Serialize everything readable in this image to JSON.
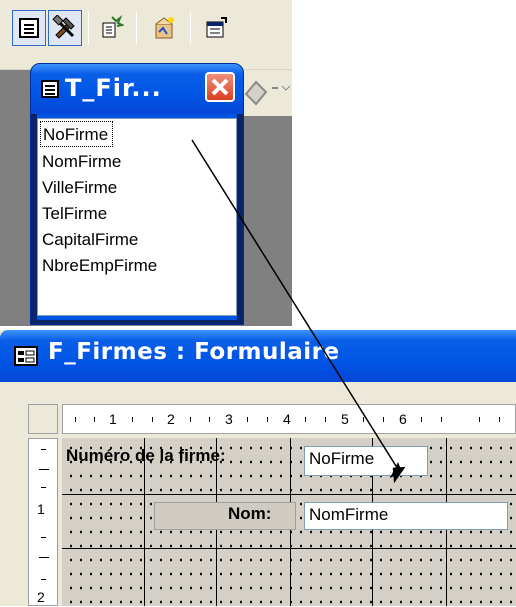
{
  "toolbar": {
    "buttons": [
      {
        "icon": "form-view-icon",
        "pressed": true
      },
      {
        "icon": "toolbox-icon",
        "pressed": true
      },
      {
        "icon": "autoformat-icon",
        "pressed": false
      },
      {
        "icon": "code-wizard-icon",
        "pressed": false
      },
      {
        "icon": "properties-icon",
        "pressed": false
      }
    ]
  },
  "field_list": {
    "title": "T_Fir...",
    "fields": [
      "NoFirme",
      "NomFirme",
      "VilleFirme",
      "TelFirme",
      "CapitalFirme",
      "NbreEmpFirme"
    ],
    "focused_index": 0
  },
  "form": {
    "title": "F_Firmes : Formulaire",
    "ruler_numbers": [
      "1",
      "2",
      "3",
      "4",
      "5",
      "6"
    ],
    "v_ruler_numbers": [
      "1",
      "2"
    ],
    "controls": [
      {
        "label": "Numéro de la firme:",
        "value": "NoFirme"
      },
      {
        "label": "Nom:",
        "value": "NomFirme"
      }
    ]
  },
  "colors": {
    "titlebar_blue": "#0055e5",
    "close_red": "#d8401e",
    "grid": "#d4d0c8"
  }
}
